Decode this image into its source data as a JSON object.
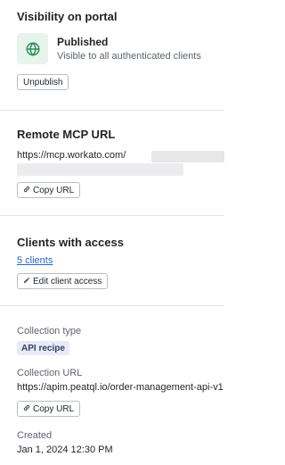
{
  "visibility": {
    "heading": "Visibility on portal",
    "status_title": "Published",
    "status_subtitle": "Visible to all authenticated clients",
    "unpublish_label": "Unpublish"
  },
  "remote_mcp": {
    "heading": "Remote MCP URL",
    "url_visible": "https://mcp.workato.com/",
    "copy_label": "Copy URL"
  },
  "clients": {
    "heading": "Clients with access",
    "count_link": "5 clients",
    "edit_label": "Edit client access"
  },
  "collection": {
    "type_label": "Collection type",
    "type_badge": "API recipe",
    "url_label": "Collection URL",
    "url_value": "https://apim.peatql.io/order-management-api-v1",
    "copy_label": "Copy URL",
    "created_label": "Created",
    "created_value": "Jan 1, 2024 12:30 PM"
  },
  "icons": {
    "status": "globe-icon",
    "copy": "link-icon",
    "edit": "pencil-icon"
  },
  "colors": {
    "accent_green": "#2e8b57",
    "link_blue": "#2a63c7",
    "badge_bg": "#e7ebf6"
  }
}
